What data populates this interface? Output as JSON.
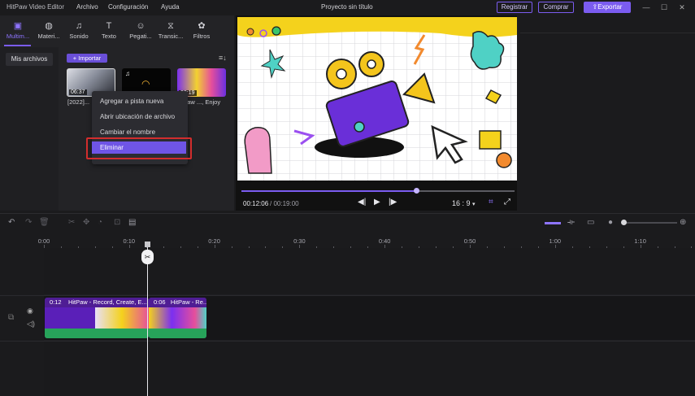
{
  "app": {
    "title": "HitPaw Video Editor",
    "project_title": "Proyecto sin título",
    "menu": [
      "Archivo",
      "Configuración",
      "Ayuda"
    ],
    "buttons": {
      "register": "Registrar",
      "buy": "Comprar",
      "export": "Exportar"
    }
  },
  "tabs": [
    {
      "label": "Multim...",
      "icon": "media-icon",
      "active": true
    },
    {
      "label": "Materi...",
      "icon": "globe-icon"
    },
    {
      "label": "Sonido",
      "icon": "music-icon"
    },
    {
      "label": "Texto",
      "icon": "text-icon"
    },
    {
      "label": "Pegati...",
      "icon": "sticker-icon"
    },
    {
      "label": "Transic...",
      "icon": "transition-icon"
    },
    {
      "label": "Filtros",
      "icon": "filter-icon"
    }
  ],
  "media": {
    "sidebar_item": "Mis archivos",
    "import_label": "+ Importar",
    "items": [
      {
        "duration": "06:37",
        "caption": "[2022]..."
      },
      {
        "duration": "",
        "caption": ""
      },
      {
        "duration": "00:19",
        "caption": "...aw ..., Enjoy"
      }
    ]
  },
  "context_menu": {
    "items": [
      "Agregar a pista nueva",
      "Abrir ubicación de archivo",
      "Cambiar el nombre"
    ],
    "highlighted": "Eliminar"
  },
  "player": {
    "current_time": "00:12:06",
    "total_time": "/ 00:19:00",
    "aspect_ratio": "16 : 9",
    "progress": 0.64
  },
  "ruler_labels": [
    "0:00",
    "0:10",
    "0:20",
    "0:30",
    "0:40",
    "0:50",
    "1:00",
    "1:10"
  ],
  "clips": [
    {
      "time": "0:12",
      "title": "HitPaw - Record, Create, E..."
    },
    {
      "time": "0:06",
      "title": "HitPaw - Re..."
    }
  ],
  "colors": {
    "accent": "#7b5cf0",
    "highlight_border": "#d22d2d",
    "audio_wave": "#27a35a"
  }
}
